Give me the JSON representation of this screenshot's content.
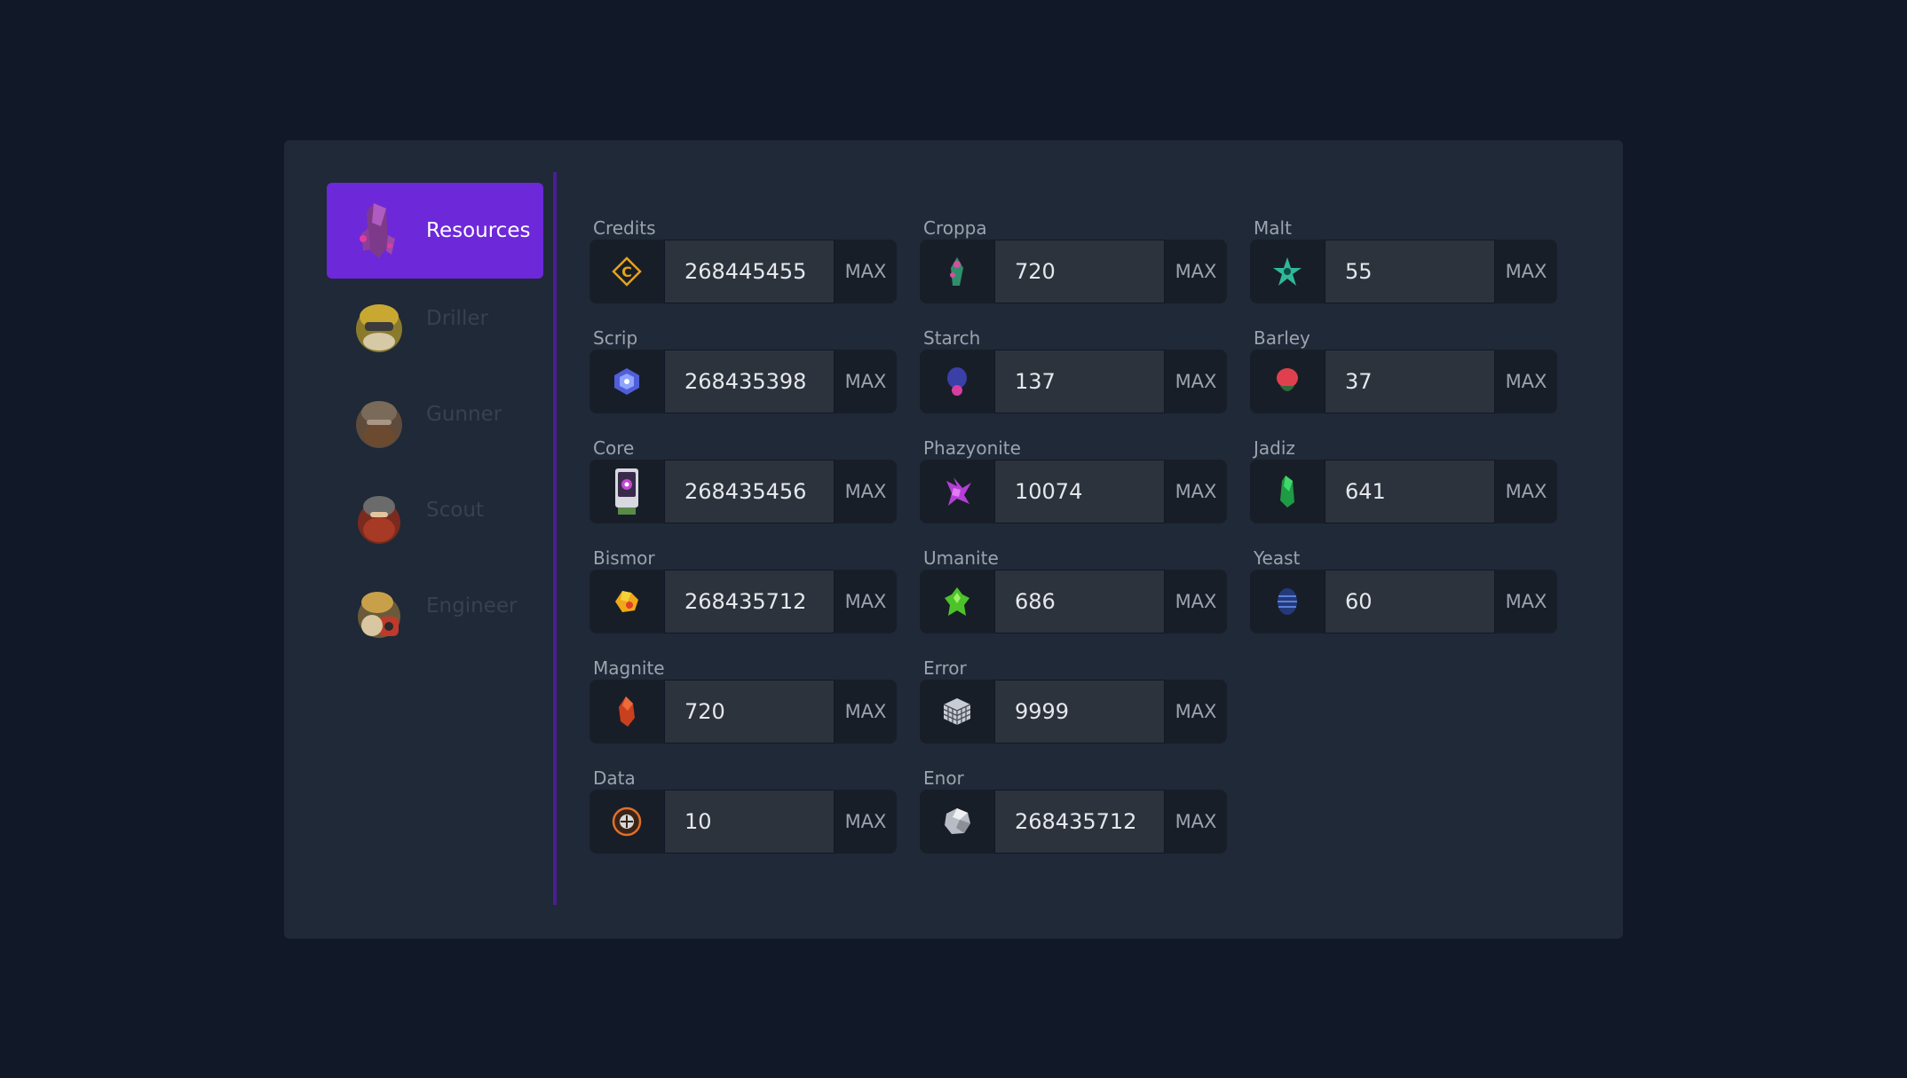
{
  "sidebar": {
    "items": [
      {
        "label": "Resources",
        "icon": "crystal-icon"
      },
      {
        "label": "Driller",
        "icon": "driller-avatar-icon"
      },
      {
        "label": "Gunner",
        "icon": "gunner-avatar-icon"
      },
      {
        "label": "Scout",
        "icon": "scout-avatar-icon"
      },
      {
        "label": "Engineer",
        "icon": "engineer-avatar-icon"
      }
    ]
  },
  "resources": {
    "max_label": "MAX",
    "credits": {
      "label": "Credits",
      "value": "268445455",
      "icon": "credits-icon"
    },
    "croppa": {
      "label": "Croppa",
      "value": "720",
      "icon": "croppa-icon"
    },
    "malt": {
      "label": "Malt",
      "value": "55",
      "icon": "malt-icon"
    },
    "scrip": {
      "label": "Scrip",
      "value": "268435398",
      "icon": "scrip-icon"
    },
    "starch": {
      "label": "Starch",
      "value": "137",
      "icon": "starch-icon"
    },
    "barley": {
      "label": "Barley",
      "value": "37",
      "icon": "barley-icon"
    },
    "core": {
      "label": "Core",
      "value": "268435456",
      "icon": "core-icon"
    },
    "phazyonite": {
      "label": "Phazyonite",
      "value": "10074",
      "icon": "phazyonite-icon"
    },
    "jadiz": {
      "label": "Jadiz",
      "value": "641",
      "icon": "jadiz-icon"
    },
    "bismor": {
      "label": "Bismor",
      "value": "268435712",
      "icon": "bismor-icon"
    },
    "umanite": {
      "label": "Umanite",
      "value": "686",
      "icon": "umanite-icon"
    },
    "yeast": {
      "label": "Yeast",
      "value": "60",
      "icon": "yeast-icon"
    },
    "magnite": {
      "label": "Magnite",
      "value": "720",
      "icon": "magnite-icon"
    },
    "error": {
      "label": "Error",
      "value": "9999",
      "icon": "error-cube-icon"
    },
    "data": {
      "label": "Data",
      "value": "10",
      "icon": "data-icon"
    },
    "enor": {
      "label": "Enor",
      "value": "268435712",
      "icon": "enor-icon"
    }
  },
  "colors": {
    "background": "#111827",
    "panel": "#1f2937",
    "accent": "#6d28d9"
  }
}
